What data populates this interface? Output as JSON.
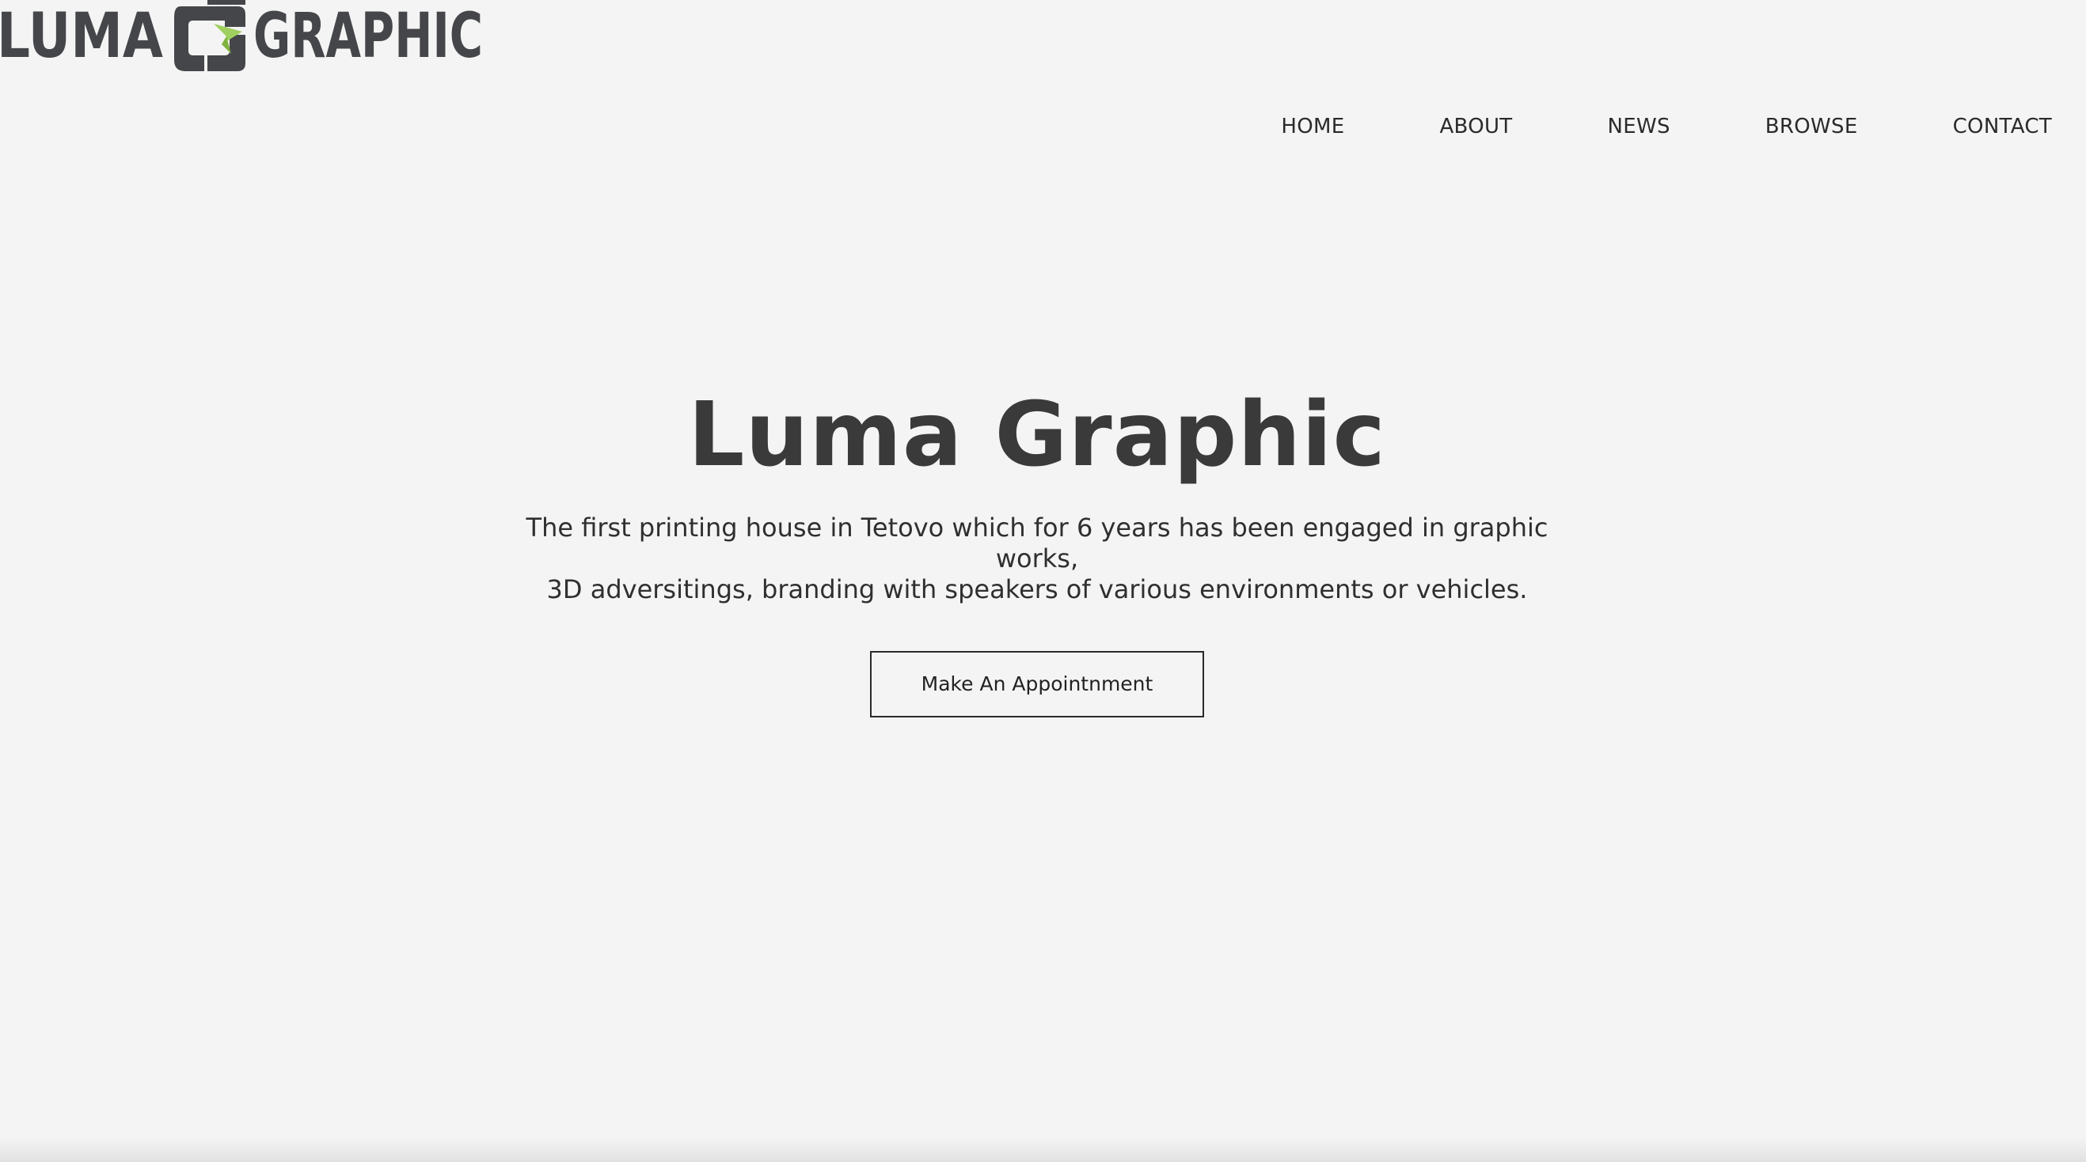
{
  "brand": {
    "logo_text_left": "LUMA",
    "logo_text_right": "GRAPHIC",
    "logo_color": "#45464a",
    "logo_accent_color": "#9fcf5f"
  },
  "nav": {
    "items": [
      {
        "label": "HOME"
      },
      {
        "label": "ABOUT"
      },
      {
        "label": "NEWS"
      },
      {
        "label": "BROWSE"
      },
      {
        "label": "CONTACT"
      }
    ]
  },
  "hero": {
    "title": "Luma Graphic",
    "description_line1": "The first printing house in Tetovo which for 6 years has been engaged in graphic works,",
    "description_line2": "3D adversitings, branding with speakers of various environments or vehicles.",
    "cta_label": "Make An Appointnment"
  },
  "colors": {
    "background": "#f4f4f4",
    "text": "#333333"
  }
}
